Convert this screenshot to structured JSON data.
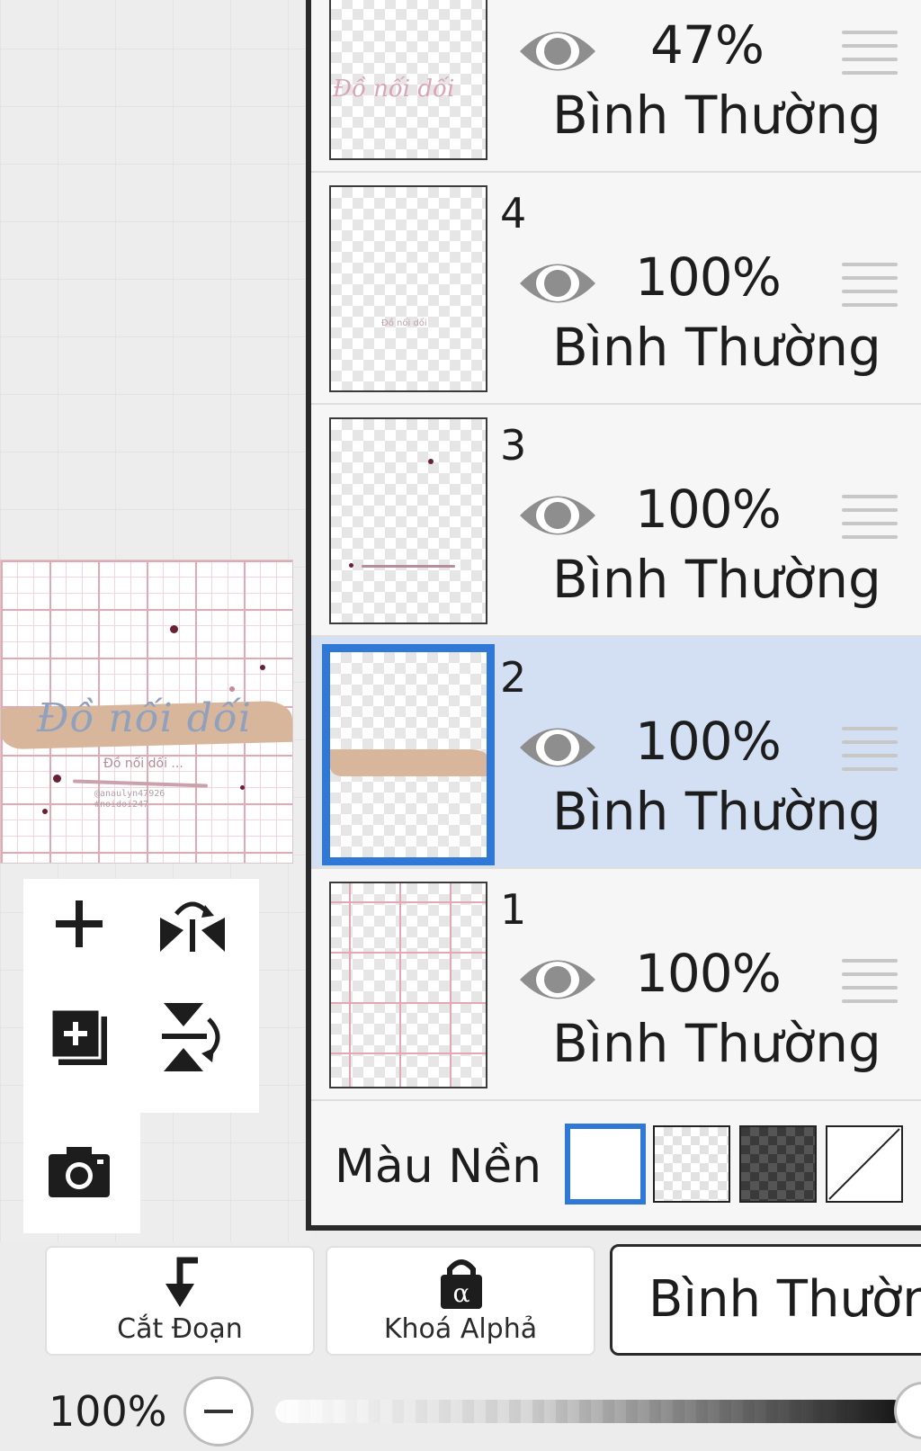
{
  "layers": [
    {
      "number": "",
      "opacity": "47%",
      "blend": "Bình Thường",
      "selected": false
    },
    {
      "number": "4",
      "opacity": "100%",
      "blend": "Bình Thường",
      "selected": false
    },
    {
      "number": "3",
      "opacity": "100%",
      "blend": "Bình Thường",
      "selected": false
    },
    {
      "number": "2",
      "opacity": "100%",
      "blend": "Bình Thường",
      "selected": true
    },
    {
      "number": "1",
      "opacity": "100%",
      "blend": "Bình Thường",
      "selected": false
    }
  ],
  "background": {
    "label": "Màu Nền",
    "options": [
      "white",
      "transparent",
      "dark-checker",
      "none"
    ],
    "selected": "white"
  },
  "toolbar": {
    "clip_label": "Cắt Đoạn",
    "alpha_lock_label": "Khoá Alphả",
    "blend_mode": "Bình Thường"
  },
  "zoom": {
    "value_label": "100%",
    "level": 1.0
  },
  "canvas": {
    "script_text": "Đồ nối dối",
    "subtitle": "Đồ nối dối ...",
    "tiny_lines": [
      "@anaulyn47926",
      "#noidoi247"
    ],
    "layer_thumb_text": [
      "Đồ nối dối",
      "Đồ nối dối"
    ]
  },
  "colors": {
    "selected_layer_bg": "#d3e0f3",
    "selection_border": "#2f78d6",
    "grid_pink": "#e2a8b4",
    "band": "#d8b69c"
  }
}
